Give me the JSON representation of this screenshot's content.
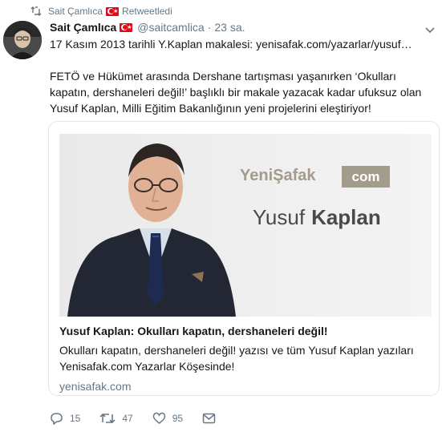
{
  "retweet": {
    "user": "Sait Çamlıca",
    "label": "Retweetledi"
  },
  "tweet": {
    "author_name": "Sait Çamlıca",
    "handle": "@saitcamlica",
    "separator": "·",
    "time": "23 sa.",
    "line1": "17 Kasım 2013 tarihli Y.Kaplan makalesi: yenisafak.com/yazarlar/yusuf…",
    "line2": "FETÖ ve Hükümet arasında Dershane tartışması yaşanırken ‘Okulları kapatın, dershaneleri değil!’ başlıklı bir makale yazacak kadar ufuksuz olan Yusuf Kaplan, Milli Eğitim Bakanlığının yeni projelerini eleştiriyor!"
  },
  "card": {
    "image_logo_left": "YeniŞafak",
    "image_logo_right": "com",
    "image_name_first": "Yusuf",
    "image_name_last": "Kaplan",
    "title": "Yusuf Kaplan: Okulları kapatın, dershaneleri değil!",
    "description": "Okulları kapatın, dershaneleri değil! yazısı ve tüm Yusuf Kaplan yazıları Yenisafak.com Yazarlar Köşesinde!",
    "domain": "yenisafak.com"
  },
  "actions": {
    "replies": "15",
    "retweets": "47",
    "likes": "95"
  },
  "colors": {
    "text": "#14171a",
    "muted": "#657786",
    "border": "#e1e8ed",
    "logo_grey": "#a39b8b",
    "flag_red": "#e30a17"
  }
}
